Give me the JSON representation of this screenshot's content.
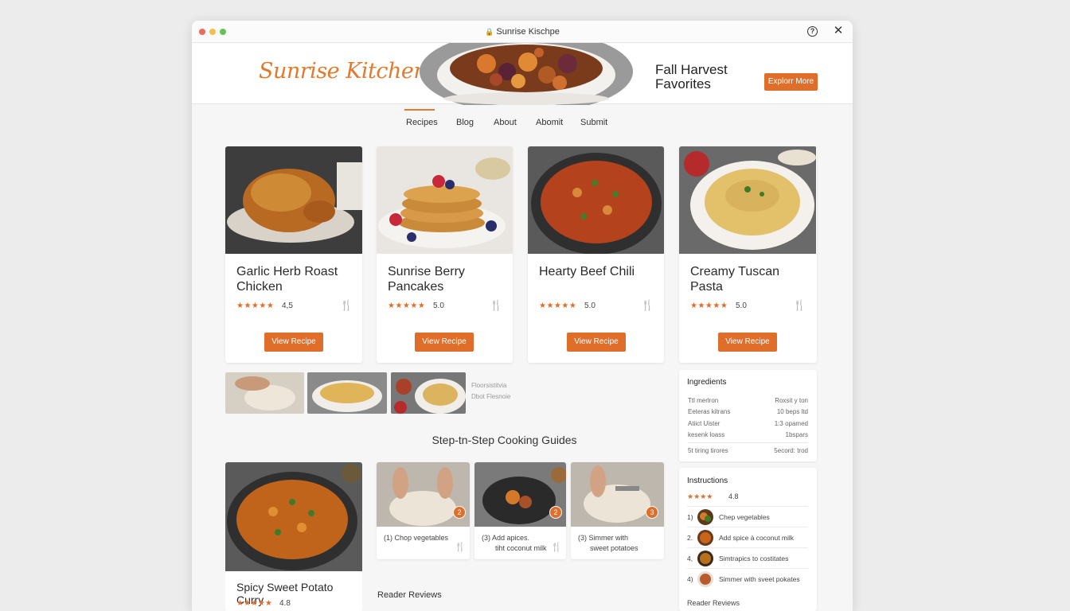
{
  "window": {
    "title": "Sunrise Kischpe",
    "colors": {
      "accent": "#df6e2b",
      "logo": "#e07a2e",
      "star": "#df6e2b"
    }
  },
  "hero": {
    "logo": "Sunrise Kitchen",
    "title": "Fall Harvest Favorites",
    "button": "Explorr More"
  },
  "nav": {
    "items": [
      "Recipes",
      "Blog",
      "About",
      "Abomit",
      "Submit"
    ],
    "active": "Recipes"
  },
  "recipes": [
    {
      "title": "Garlic Herb Roast Chicken",
      "stars": "★★★★★",
      "rating": "4,5",
      "button": "View Recipe"
    },
    {
      "title": "Sunrise Berry Pancakes",
      "stars": "★★★★★",
      "rating": "5.0",
      "button": "View Recipe"
    },
    {
      "title": "Hearty Beef Chili",
      "stars": "★★★★★",
      "rating": "5.0",
      "button": "View Recipe"
    },
    {
      "title": "Creamy Tuscan Pasta",
      "stars": "★★★★★",
      "rating": "5.0",
      "button": "View Recipe"
    }
  ],
  "thumbnails": {
    "caption_line1": "Floorsistitvia",
    "caption_line2": "Dbot Flesnoie"
  },
  "guides": {
    "title": "Step-tn-Step Cooking Guides",
    "featured": {
      "title": "Spicy Sweet Potato Curry",
      "stars": "★★★★★",
      "rating": "4.8"
    },
    "steps": [
      {
        "badge": "2",
        "line1": "(1)  Chop vegetables",
        "line2": ""
      },
      {
        "badge": "2",
        "line1": "(3)  Add apices.",
        "line2": "tiht  coconut milk"
      },
      {
        "badge": "3",
        "line1": "(3)  Simmer with",
        "line2": "sweet potatoes"
      }
    ],
    "reader_reviews": "Reader Reviews"
  },
  "ingredients": {
    "title": "Ingredients",
    "rows": [
      {
        "left": "Ttl merlron",
        "right": "Roxsit y ton"
      },
      {
        "left": "Eeteras kitrans",
        "right": "10 beps ltd"
      },
      {
        "left": "Atiict Uister",
        "right": "1:3 opamed"
      },
      {
        "left": "kesenk loass",
        "right": "1bspars"
      },
      {
        "left": "5t tiring tirores",
        "right": "5ecord: trod"
      }
    ]
  },
  "instructions": {
    "title": "Instructions",
    "stars": "★★★★",
    "rating": "4.8",
    "steps": [
      {
        "num": "1)",
        "text": "Chep vegetables"
      },
      {
        "num": "2.",
        "text": "Add spice à coconut milk"
      },
      {
        "num": "4,",
        "text": "Simtrapics to costitates"
      },
      {
        "num": "4)",
        "text": "Simmer with sveet pokates"
      }
    ],
    "footer": "Reader Reviews"
  }
}
